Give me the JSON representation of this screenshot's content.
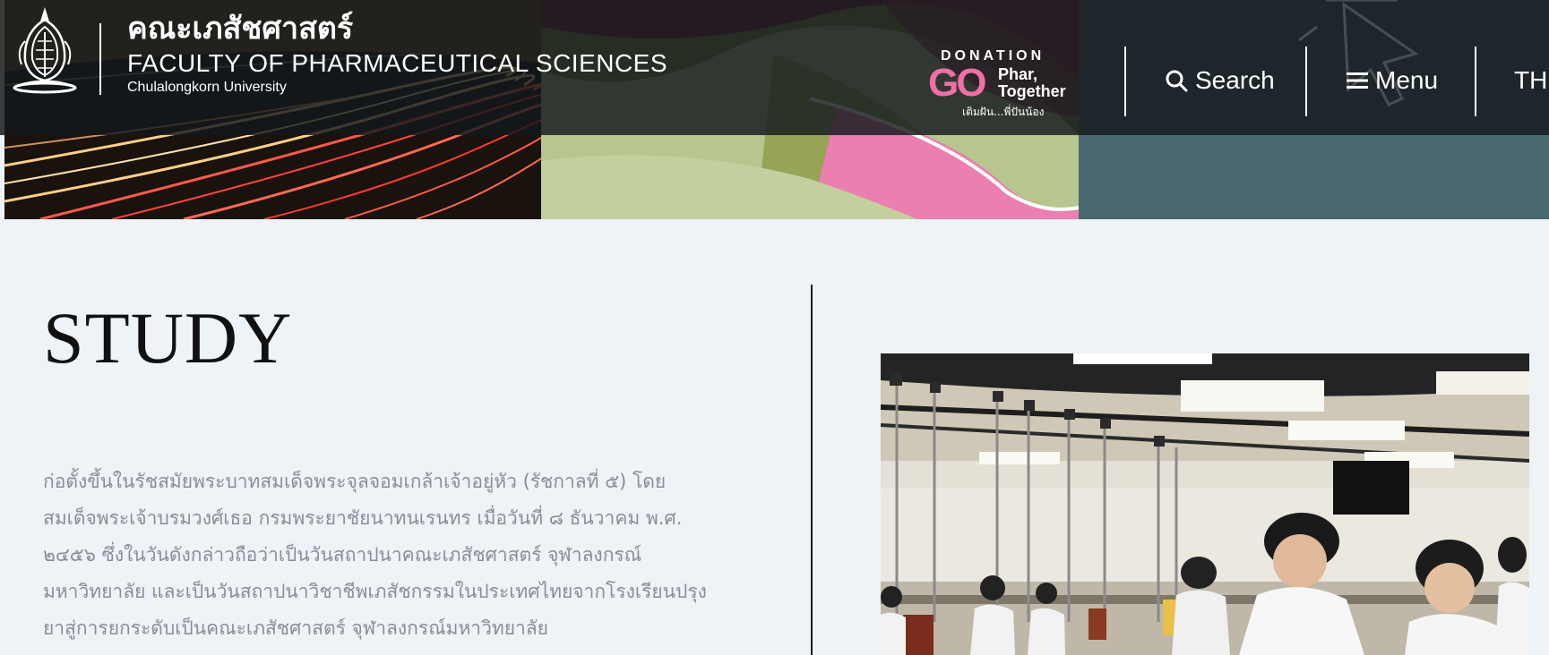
{
  "header": {
    "logo_th": "คณะเภสัชศาสตร์",
    "logo_en": "FACULTY OF PHARMACEUTICAL SCIENCES",
    "logo_university": "Chulalongkorn University",
    "donation": {
      "title": "DONATION",
      "go": "GO",
      "phar": "Phar,",
      "together": "Together",
      "tagline": "เติมฝัน...พี่ปันน้อง",
      "pink": "#ef6fa6"
    },
    "nav": {
      "search_label": "Search",
      "menu_label": "Menu",
      "language_label": "TH"
    }
  },
  "main": {
    "title": "STUDY",
    "paragraph_lines": [
      "ก่อตั้งขึ้นในรัชสมัยพระบาทสมเด็จพระจุลจอมเกล้าเจ้าอยู่หัว (รัชกาลที่ ๕) โดย",
      "สมเด็จพระเจ้าบรมวงศ์เธอ กรมพระยาชัยนาทนเรนทร เมื่อวันที่ ๘ ธันวาคม พ.ศ.",
      "๒๔๕๖ ซึ่งในวันดังกล่าวถือว่าเป็นวันสถาปนาคณะเภสัชศาสตร์ จุฬาลงกรณ์",
      "มหาวิทยาลัย และเป็นวันสถาปนาวิชาชีพเภสัชกรรมในประเทศไทยจากโรงเรียนปรุง",
      "ยาสู่การยกระดับเป็นคณะเภสัชศาสตร์ จุฬาลงกรณ์มหาวิทยาลัย"
    ]
  },
  "colors": {
    "page_background": "#eef3f7",
    "header_overlay": "#14181c",
    "body_text": "#888e96",
    "title_text": "#111111"
  },
  "icons": {
    "logo": "chula-emblem-icon",
    "search": "search-icon",
    "menu": "hamburger-menu-icon",
    "cursor": "cursor-arrow-icon"
  }
}
